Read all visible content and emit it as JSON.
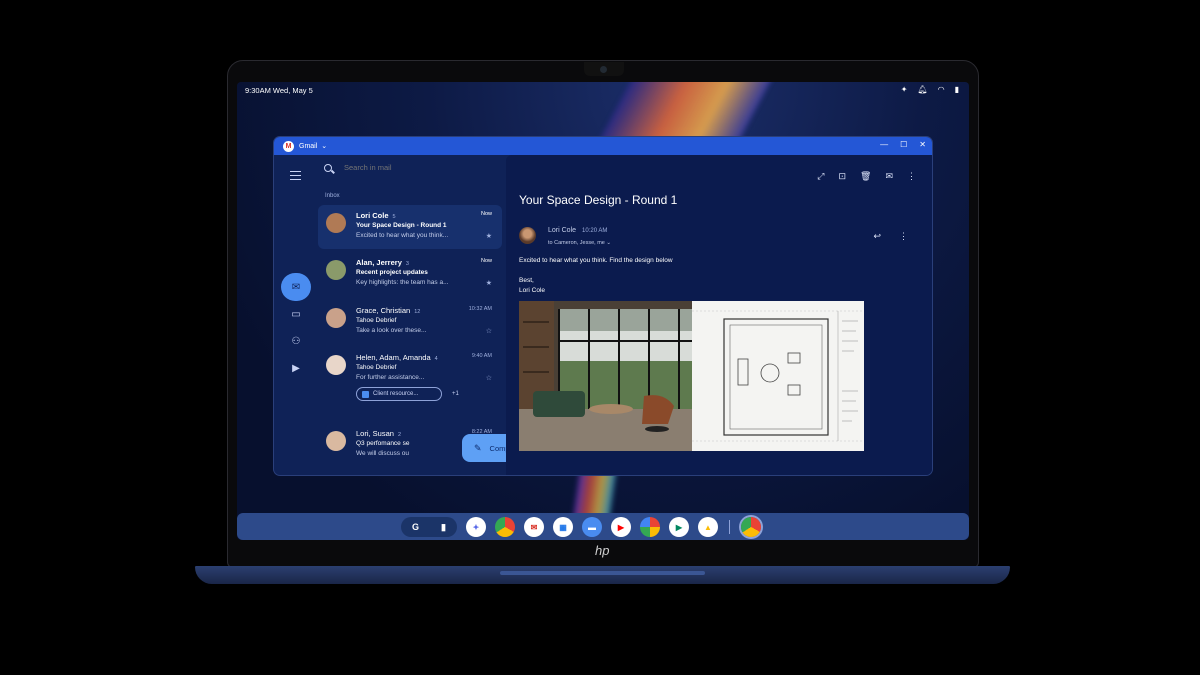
{
  "status": {
    "time_date": "9:30AM  Wed, May 5"
  },
  "window": {
    "app_name": "Gmail",
    "app_letter": "M"
  },
  "search": {
    "placeholder": "Search in mail"
  },
  "list": {
    "section": "Inbox",
    "items": [
      {
        "sender": "Lori Cole",
        "count": "5",
        "time": "Now",
        "subject": "Your Space Design - Round 1",
        "snippet": "Excited to hear what you think...",
        "starred": true,
        "unread": true,
        "avatar_color": "#b07a55"
      },
      {
        "sender": "Alan, Jerrery",
        "count": "3",
        "time": "Now",
        "subject": "Recent project updates",
        "snippet": "Key highlights: the team has a...",
        "starred": true,
        "unread": true,
        "avatar_color": "#8a9a6a"
      },
      {
        "sender": "Grace, Christian",
        "count": "12",
        "time": "10:32 AM",
        "subject": "Tahoe Debrief",
        "snippet": "Take a look over these...",
        "starred": false,
        "unread": false,
        "avatar_color": "#c9a18a"
      },
      {
        "sender": "Helen, Adam, Amanda",
        "count": "4",
        "time": "9:40 AM",
        "subject": "Tahoe Debrief",
        "snippet": "For further assistance...",
        "starred": false,
        "unread": false,
        "avatar_color": "#e8d6c9",
        "attachment": "Client resource...",
        "attachment_more": "+1"
      },
      {
        "sender": "Lori, Susan",
        "count": "2",
        "time": "8:22 AM",
        "subject": "Q3 perfomance se",
        "snippet": "We will discuss ou",
        "starred": false,
        "unread": false,
        "avatar_color": "#d9b9a0"
      }
    ]
  },
  "compose": {
    "label": "Compose"
  },
  "message": {
    "subject": "Your Space Design - Round 1",
    "from": "Lori Cole",
    "time": "10:20 AM",
    "to": "to Cameron, Jesse, me",
    "body": "Excited to hear what you think. Find the design below",
    "sign_off": "Best,",
    "signature": "Lori Cole"
  },
  "shelf": {
    "launcher_label": "G"
  },
  "brand": {
    "logo_text": "hp"
  },
  "colors": {
    "titlebar": "#2457d6",
    "accent": "#5ea0f5",
    "window_bg": "#0f2257"
  }
}
